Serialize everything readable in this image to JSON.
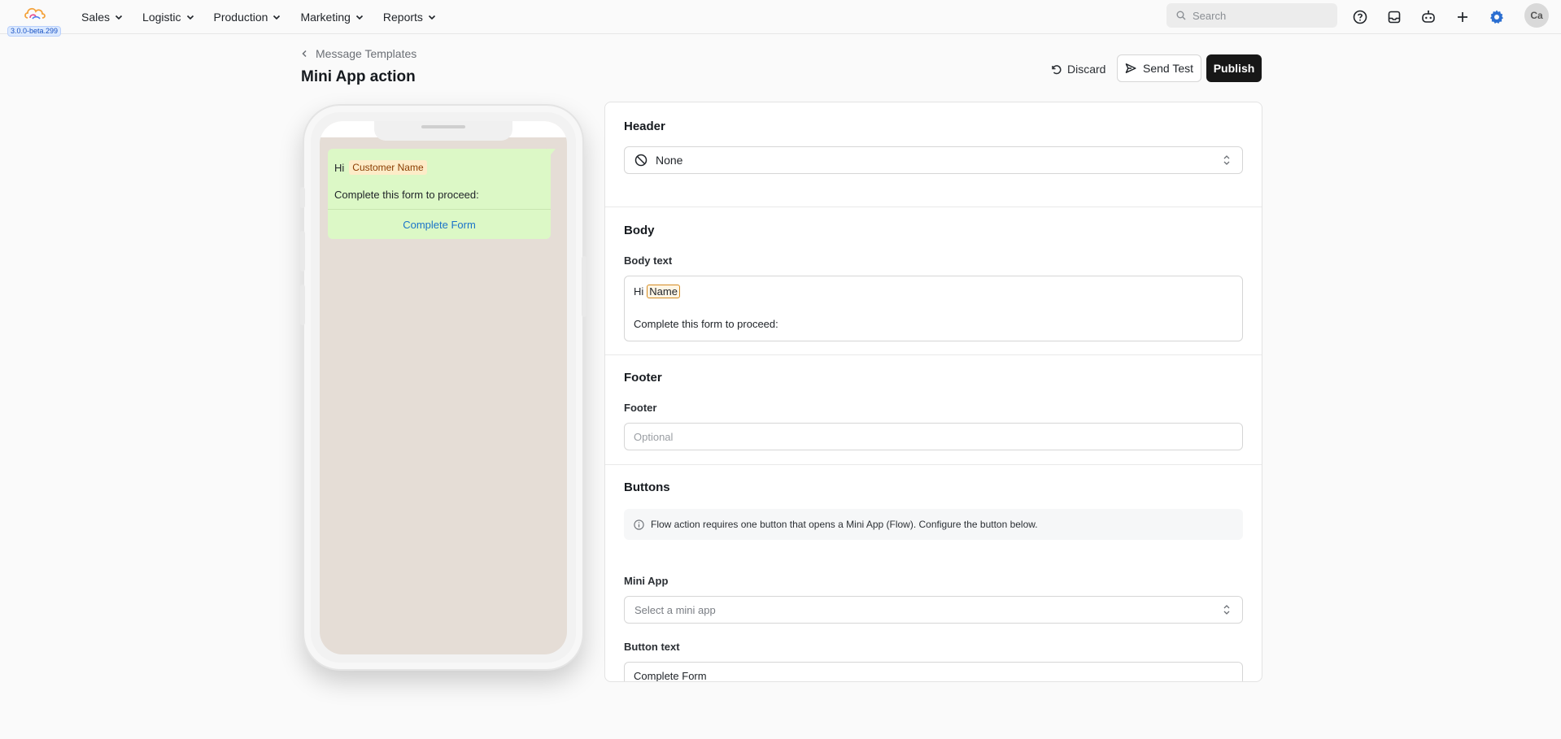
{
  "app": {
    "version": "3.0.0-beta.299"
  },
  "nav": {
    "menu": [
      {
        "label": "Sales"
      },
      {
        "label": "Logistic"
      },
      {
        "label": "Production"
      },
      {
        "label": "Marketing"
      },
      {
        "label": "Reports"
      }
    ],
    "search_placeholder": "Search",
    "avatar_initials": "Ca",
    "accent": "#2c6fd1"
  },
  "page": {
    "breadcrumb": "Message Templates",
    "title": "Mini App action",
    "discard_label": "Discard",
    "send_test_label": "Send Test",
    "publish_label": "Publish"
  },
  "preview": {
    "greeting": "Hi",
    "variable_label": "Customer Name",
    "body": "Complete this form to proceed:",
    "button_label": "Complete Form",
    "bubble_color": "#dcf8c6",
    "chat_bg": "#e5ddd6"
  },
  "header_section": {
    "title": "Header",
    "selected": "None"
  },
  "body_section": {
    "title": "Body",
    "field_label": "Body text",
    "greeting": "Hi",
    "variable": "Name",
    "text": "Complete this form to proceed:"
  },
  "footer_section": {
    "title": "Footer",
    "field_label": "Footer",
    "placeholder": "Optional",
    "value": ""
  },
  "buttons_section": {
    "title": "Buttons",
    "info": "Flow action requires one button that opens a Mini App (Flow). Configure the button below.",
    "mini_app_label": "Mini App",
    "mini_app_placeholder": "Select a mini app",
    "button_text_label": "Button text",
    "button_text_value": "Complete Form"
  }
}
